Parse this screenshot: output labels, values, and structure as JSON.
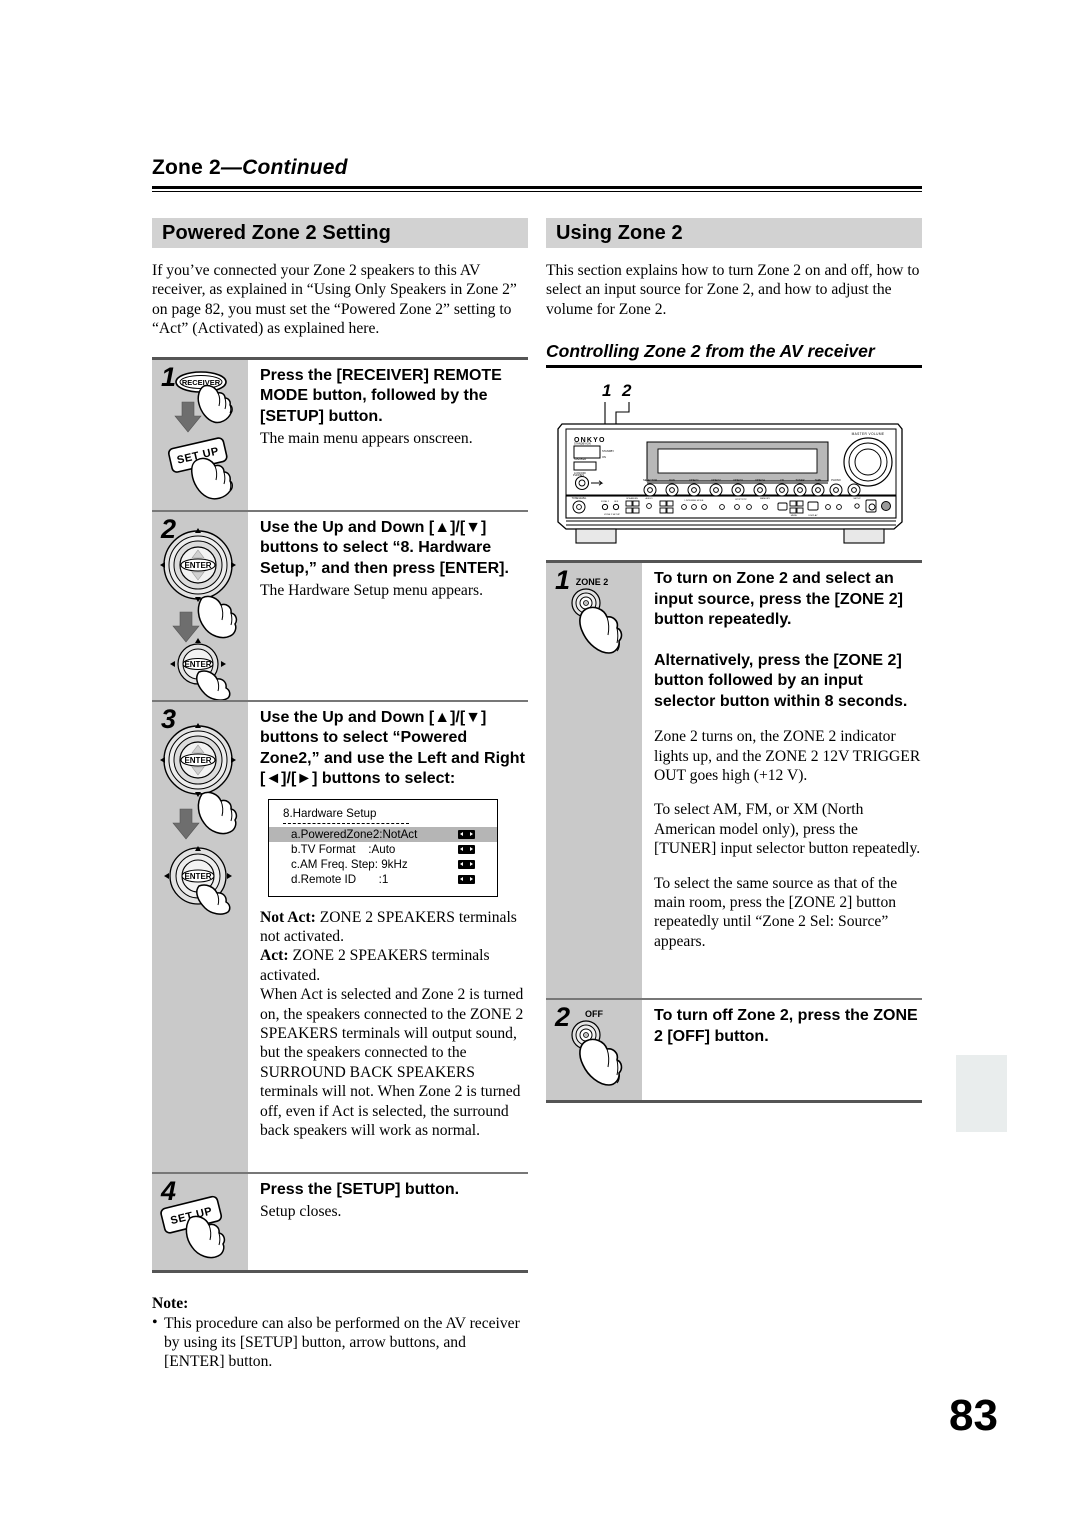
{
  "running_head": {
    "title": "Zone 2",
    "continued": "—Continued"
  },
  "page_number": "83",
  "left_column": {
    "section_title": "Powered Zone 2 Setting",
    "intro": "If you’ve connected your Zone 2 speakers to this AV receiver, as explained in “Using Only Speakers in Zone 2” on page 82, you must set the “Powered Zone 2” setting to “Act” (Activated) as explained here.",
    "steps": [
      {
        "number": "1",
        "title": "Press the [RECEIVER] REMOTE MODE button, followed by the [SETUP] button.",
        "sub": "The main menu appears onscreen.",
        "icon_labels": {
          "top": "RECEIVER",
          "bottom": "SET UP"
        }
      },
      {
        "number": "2",
        "title": "Use the Up and Down [▲]/[▼] buttons to select “8. Hardware Setup,” and then press [ENTER].",
        "sub": "The Hardware Setup menu appears.",
        "icon_labels": {
          "top": "ENTER",
          "bottom": "ENTER"
        }
      },
      {
        "number": "3",
        "title": "Use the Up and Down [▲]/[▼] buttons to select “Powered Zone2,” and use the Left and Right [◄]/[►] buttons to select:",
        "icon_labels": {
          "top": "ENTER",
          "bottom": "ENTER"
        },
        "osd": {
          "title": "8.Hardware Setup",
          "rows": [
            {
              "label": "a.PoweredZone2:NotAct",
              "selected": true
            },
            {
              "label": "b.TV Format    :Auto",
              "selected": false
            },
            {
              "label": "c.AM Freq. Step: 9kHz",
              "selected": false
            },
            {
              "label": "d.Remote ID       :1",
              "selected": false
            }
          ]
        },
        "paragraphs": [
          "Not Act: ZONE 2 SPEAKERS terminals not activated.",
          "Act: ZONE 2 SPEAKERS terminals activated.",
          "When Act is selected and Zone 2 is turned on, the speakers connected to the ZONE 2 SPEAKERS terminals will output sound, but the speakers connected to the SURROUND BACK SPEAKERS terminals will not. When Zone 2 is turned off, even if Act is selected, the surround back speakers will work as normal."
        ],
        "bold_leads": [
          "Not Act:",
          "Act:"
        ]
      },
      {
        "number": "4",
        "title": "Press the [SETUP] button.",
        "sub": "Setup closes.",
        "icon_labels": {
          "bottom": "SET UP"
        }
      }
    ],
    "note": {
      "heading": "Note:",
      "bullet": "•",
      "items": [
        "This procedure can also be performed on the AV receiver by using its [SETUP] button, arrow buttons, and [ENTER] button."
      ]
    }
  },
  "right_column": {
    "section_title": "Using Zone 2",
    "intro": "This section explains how to turn Zone 2 on and off, how to select an input source for Zone 2, and how to adjust the volume for Zone 2.",
    "sub_heading": "Controlling Zone 2 from the AV receiver",
    "figure": {
      "name": "av-receiver-front-panel",
      "brand": "ONKYO",
      "callouts": [
        "1",
        "2"
      ],
      "master_volume_label": "MASTER VOLUME"
    },
    "steps": [
      {
        "number": "1",
        "icon_label": "ZONE 2",
        "title": "To turn on Zone 2 and select an input source, press the [ZONE 2] button repeatedly.",
        "title2": "Alternatively, press the [ZONE 2] button followed by an input selector button within 8 seconds.",
        "paragraphs": [
          "Zone 2 turns on, the ZONE 2 indicator lights up, and the ZONE 2 12V TRIGGER OUT goes high (+12 V).",
          "To select AM, FM, or XM (North American model only), press the [TUNER] input selector button repeatedly.",
          "To select the same source as that of the main room, press the [ZONE 2] button repeatedly until “Zone 2 Sel: Source” appears."
        ]
      },
      {
        "number": "2",
        "icon_label": "OFF",
        "title": "To turn off Zone 2, press the ZONE 2 [OFF] button."
      }
    ]
  },
  "colors": {
    "step_icon_bg": "#c9c9c9",
    "section_bar_bg": "#d2d2d2",
    "osd_selected_bg": "#b5b5b5",
    "thumb_tab_bg": "#e9eded",
    "rule": "#000000"
  }
}
